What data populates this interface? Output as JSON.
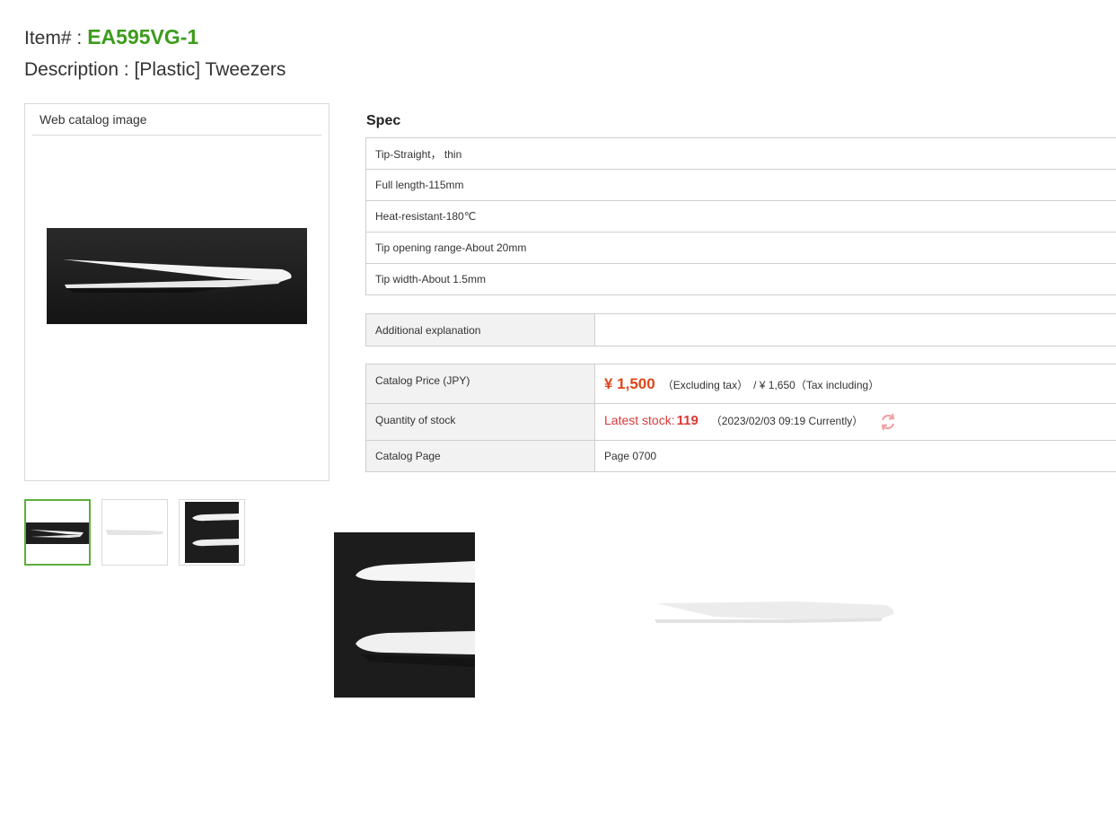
{
  "header": {
    "item_label": "Item# :",
    "item_code": "EA595VG-1",
    "description": "Description : [Plastic] Tweezers"
  },
  "gallery": {
    "title": "Web catalog image",
    "thumbnails": [
      "tweezers-dark-photo",
      "tweezers-light-photo",
      "tweezers-tip-closeup"
    ],
    "selected_index": 0
  },
  "spec": {
    "title": "Spec",
    "rows": [
      "Tip-Straight， thin",
      "Full length-115mm",
      "Heat-resistant-180℃",
      "Tip opening range-About 20mm",
      "Tip width-About 1.5mm"
    ]
  },
  "additional": {
    "label": "Additional explanation",
    "value": ""
  },
  "catalog": {
    "price_label": "Catalog Price (JPY)",
    "price": "¥ 1,500",
    "price_excl": "（Excluding tax）",
    "price_incl": "/ ¥ 1,650（Tax including）",
    "stock_label": "Quantity of stock",
    "stock_prefix": "Latest stock:",
    "stock_value": "119",
    "stock_time": "（2023/02/03 09:19 Currently）",
    "page_label": "Catalog Page",
    "page_value": "Page 0700"
  },
  "colors": {
    "item_code": "#3c9c1c",
    "price": "#e0461a",
    "stock": "#d93a3a",
    "selected_border": "#5cae3c"
  },
  "icons": {
    "refresh": "refresh-icon"
  }
}
